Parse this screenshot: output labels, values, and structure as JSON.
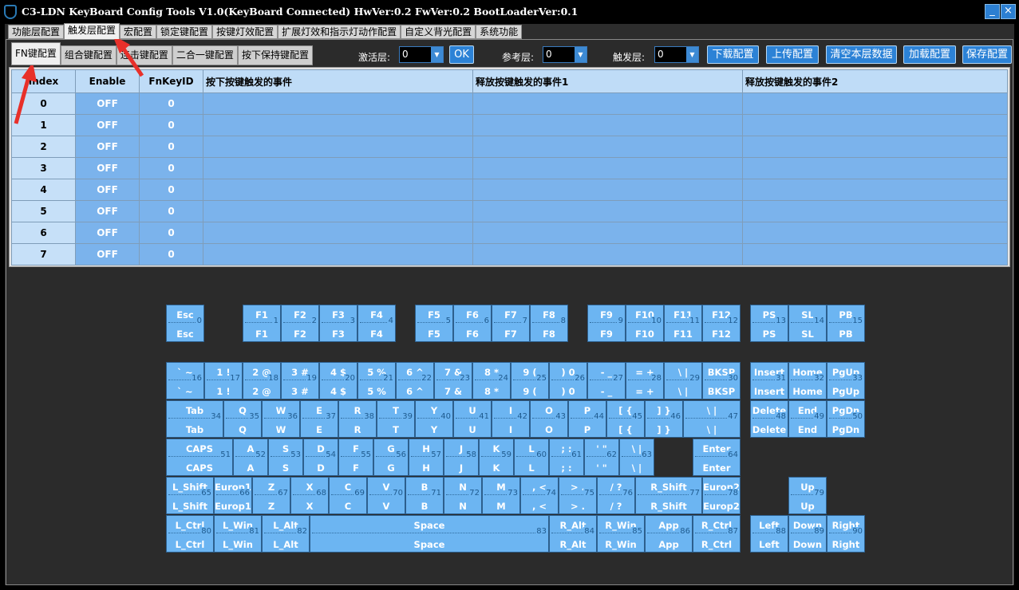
{
  "window": {
    "title": "C3-LDN KeyBoard Config Tools V1.0(KeyBoard Connected)  HwVer:0.2  FwVer:0.2  BootLoaderVer:0.1",
    "minimize": "_",
    "close": "×"
  },
  "top_tabs": [
    "功能层配置",
    "触发层配置",
    "宏配置",
    "锁定键配置",
    "按键灯效配置",
    "扩展灯效和指示灯动作配置",
    "自定义背光配置",
    "系统功能"
  ],
  "top_tab_active": 1,
  "sub_tabs": [
    "FN键配置",
    "组合键配置",
    "连击键配置",
    "二合一键配置",
    "按下保持键配置"
  ],
  "sub_tab_active": 0,
  "controls": {
    "activate_layer_label": "激活层:",
    "activate_layer_value": "0",
    "ok_label": "OK",
    "ref_layer_label": "参考层:",
    "ref_layer_value": "0",
    "trigger_layer_label": "触发层:",
    "trigger_layer_value": "0",
    "download_label": "下载配置",
    "upload_label": "上传配置",
    "clear_label": "清空本层数据",
    "load_label": "加载配置",
    "save_label": "保存配置"
  },
  "table": {
    "headers": [
      "Index",
      "Enable",
      "FnKeyID",
      "按下按键触发的事件",
      "释放按键触发的事件1",
      "释放按键触发的事件2"
    ],
    "rows": [
      [
        "0",
        "OFF",
        "0",
        "",
        "",
        ""
      ],
      [
        "1",
        "OFF",
        "0",
        "",
        "",
        ""
      ],
      [
        "2",
        "OFF",
        "0",
        "",
        "",
        ""
      ],
      [
        "3",
        "OFF",
        "0",
        "",
        "",
        ""
      ],
      [
        "4",
        "OFF",
        "0",
        "",
        "",
        ""
      ],
      [
        "5",
        "OFF",
        "0",
        "",
        "",
        ""
      ],
      [
        "6",
        "OFF",
        "0",
        "",
        "",
        ""
      ],
      [
        "7",
        "OFF",
        "0",
        "",
        "",
        ""
      ]
    ]
  },
  "keyboard": [
    {
      "top": "Esc",
      "bottom": "Esc",
      "n": "0"
    },
    {
      "top": "F1",
      "bottom": "F1",
      "n": "1"
    },
    {
      "top": "F2",
      "bottom": "F2",
      "n": "2"
    },
    {
      "top": "F3",
      "bottom": "F3",
      "n": "3"
    },
    {
      "top": "F4",
      "bottom": "F4",
      "n": "4"
    },
    {
      "top": "F5",
      "bottom": "F5",
      "n": "5"
    },
    {
      "top": "F6",
      "bottom": "F6",
      "n": "6"
    },
    {
      "top": "F7",
      "bottom": "F7",
      "n": "7"
    },
    {
      "top": "F8",
      "bottom": "F8",
      "n": "8"
    },
    {
      "top": "F9",
      "bottom": "F9",
      "n": "9"
    },
    {
      "top": "F10",
      "bottom": "F10",
      "n": "10"
    },
    {
      "top": "F11",
      "bottom": "F11",
      "n": "11"
    },
    {
      "top": "F12",
      "bottom": "F12",
      "n": "12"
    },
    {
      "top": "PS",
      "bottom": "PS",
      "n": "13"
    },
    {
      "top": "SL",
      "bottom": "SL",
      "n": "14"
    },
    {
      "top": "PB",
      "bottom": "PB",
      "n": "15"
    },
    {
      "top": "` ~",
      "bottom": "` ~",
      "n": "16"
    },
    {
      "top": "1 !",
      "bottom": "1 !",
      "n": "17"
    },
    {
      "top": "2 @",
      "bottom": "2 @",
      "n": "18"
    },
    {
      "top": "3 #",
      "bottom": "3 #",
      "n": "19"
    },
    {
      "top": "4 $",
      "bottom": "4 $",
      "n": "20"
    },
    {
      "top": "5 %",
      "bottom": "5 %",
      "n": "21"
    },
    {
      "top": "6 ^",
      "bottom": "6 ^",
      "n": "22"
    },
    {
      "top": "7 &",
      "bottom": "7 &",
      "n": "23"
    },
    {
      "top": "8 *",
      "bottom": "8 *",
      "n": "24"
    },
    {
      "top": "9 (",
      "bottom": "9 (",
      "n": "25"
    },
    {
      "top": ") 0",
      "bottom": ") 0",
      "n": "26"
    },
    {
      "top": "- _",
      "bottom": "- _",
      "n": "27"
    },
    {
      "top": "= +",
      "bottom": "= +",
      "n": "28"
    },
    {
      "top": "\\ |",
      "bottom": "\\ |",
      "n": "29"
    },
    {
      "top": "BKSP",
      "bottom": "BKSP",
      "n": "30"
    },
    {
      "top": "Insert",
      "bottom": "Insert",
      "n": "31"
    },
    {
      "top": "Home",
      "bottom": "Home",
      "n": "32"
    },
    {
      "top": "PgUp",
      "bottom": "PgUp",
      "n": "33"
    },
    {
      "top": "Tab",
      "bottom": "Tab",
      "n": "34"
    },
    {
      "top": "Q",
      "bottom": "Q",
      "n": "35"
    },
    {
      "top": "W",
      "bottom": "W",
      "n": "36"
    },
    {
      "top": "E",
      "bottom": "E",
      "n": "37"
    },
    {
      "top": "R",
      "bottom": "R",
      "n": "38"
    },
    {
      "top": "T",
      "bottom": "T",
      "n": "39"
    },
    {
      "top": "Y",
      "bottom": "Y",
      "n": "40"
    },
    {
      "top": "U",
      "bottom": "U",
      "n": "41"
    },
    {
      "top": "I",
      "bottom": "I",
      "n": "42"
    },
    {
      "top": "O",
      "bottom": "O",
      "n": "43"
    },
    {
      "top": "P",
      "bottom": "P",
      "n": "44"
    },
    {
      "top": "[ {",
      "bottom": "[ {",
      "n": "45"
    },
    {
      "top": "] }",
      "bottom": "] }",
      "n": "46"
    },
    {
      "top": "\\ |",
      "bottom": "\\ |",
      "n": "47"
    },
    {
      "top": "Delete",
      "bottom": "Delete",
      "n": "48"
    },
    {
      "top": "End",
      "bottom": "End",
      "n": "49"
    },
    {
      "top": "PgDn",
      "bottom": "PgDn",
      "n": "50"
    },
    {
      "top": "CAPS",
      "bottom": "CAPS",
      "n": "51"
    },
    {
      "top": "A",
      "bottom": "A",
      "n": "52"
    },
    {
      "top": "S",
      "bottom": "S",
      "n": "53"
    },
    {
      "top": "D",
      "bottom": "D",
      "n": "54"
    },
    {
      "top": "F",
      "bottom": "F",
      "n": "55"
    },
    {
      "top": "G",
      "bottom": "G",
      "n": "56"
    },
    {
      "top": "H",
      "bottom": "H",
      "n": "57"
    },
    {
      "top": "J",
      "bottom": "J",
      "n": "58"
    },
    {
      "top": "K",
      "bottom": "K",
      "n": "59"
    },
    {
      "top": "L",
      "bottom": "L",
      "n": "60"
    },
    {
      "top": "; :",
      "bottom": "; :",
      "n": "61"
    },
    {
      "top": "' \"",
      "bottom": "' \"",
      "n": "62"
    },
    {
      "top": "\\ |",
      "bottom": "\\ |",
      "n": "63"
    },
    {
      "top": "Enter",
      "bottom": "Enter",
      "n": "64"
    },
    {
      "top": "L_Shift",
      "bottom": "L_Shift",
      "n": "65"
    },
    {
      "top": "Europ1",
      "bottom": "Europ1",
      "n": "66"
    },
    {
      "top": "Z",
      "bottom": "Z",
      "n": "67"
    },
    {
      "top": "X",
      "bottom": "X",
      "n": "68"
    },
    {
      "top": "C",
      "bottom": "C",
      "n": "69"
    },
    {
      "top": "V",
      "bottom": "V",
      "n": "70"
    },
    {
      "top": "B",
      "bottom": "B",
      "n": "71"
    },
    {
      "top": "N",
      "bottom": "N",
      "n": "72"
    },
    {
      "top": "M",
      "bottom": "M",
      "n": "73"
    },
    {
      "top": ", <",
      "bottom": ", <",
      "n": "74"
    },
    {
      "top": "> .",
      "bottom": "> .",
      "n": "75"
    },
    {
      "top": "/ ?",
      "bottom": "/ ?",
      "n": "76"
    },
    {
      "top": "R_Shift",
      "bottom": "R_Shift",
      "n": "77"
    },
    {
      "top": "Europ2",
      "bottom": "Europ2",
      "n": "78"
    },
    {
      "top": "Up",
      "bottom": "Up",
      "n": "79"
    },
    {
      "top": "L_Ctrl",
      "bottom": "L_Ctrl",
      "n": "80"
    },
    {
      "top": "L_Win",
      "bottom": "L_Win",
      "n": "81"
    },
    {
      "top": "L_Alt",
      "bottom": "L_Alt",
      "n": "82"
    },
    {
      "top": "Space",
      "bottom": "Space",
      "n": "83"
    },
    {
      "top": "R_Alt",
      "bottom": "R_Alt",
      "n": "84"
    },
    {
      "top": "R_Win",
      "bottom": "R_Win",
      "n": "85"
    },
    {
      "top": "App",
      "bottom": "App",
      "n": "86"
    },
    {
      "top": "R_Ctrl",
      "bottom": "R_Ctrl",
      "n": "87"
    },
    {
      "top": "Left",
      "bottom": "Left",
      "n": "88"
    },
    {
      "top": "Down",
      "bottom": "Down",
      "n": "89"
    },
    {
      "top": "Right",
      "bottom": "Right",
      "n": "90"
    }
  ],
  "colors": {
    "key_fill": "#6cb5f2",
    "table_cell": "#7bb3ec",
    "table_header": "#bfdcf7",
    "button": "#2c82d6",
    "annotation_arrow": "#e8302a"
  }
}
